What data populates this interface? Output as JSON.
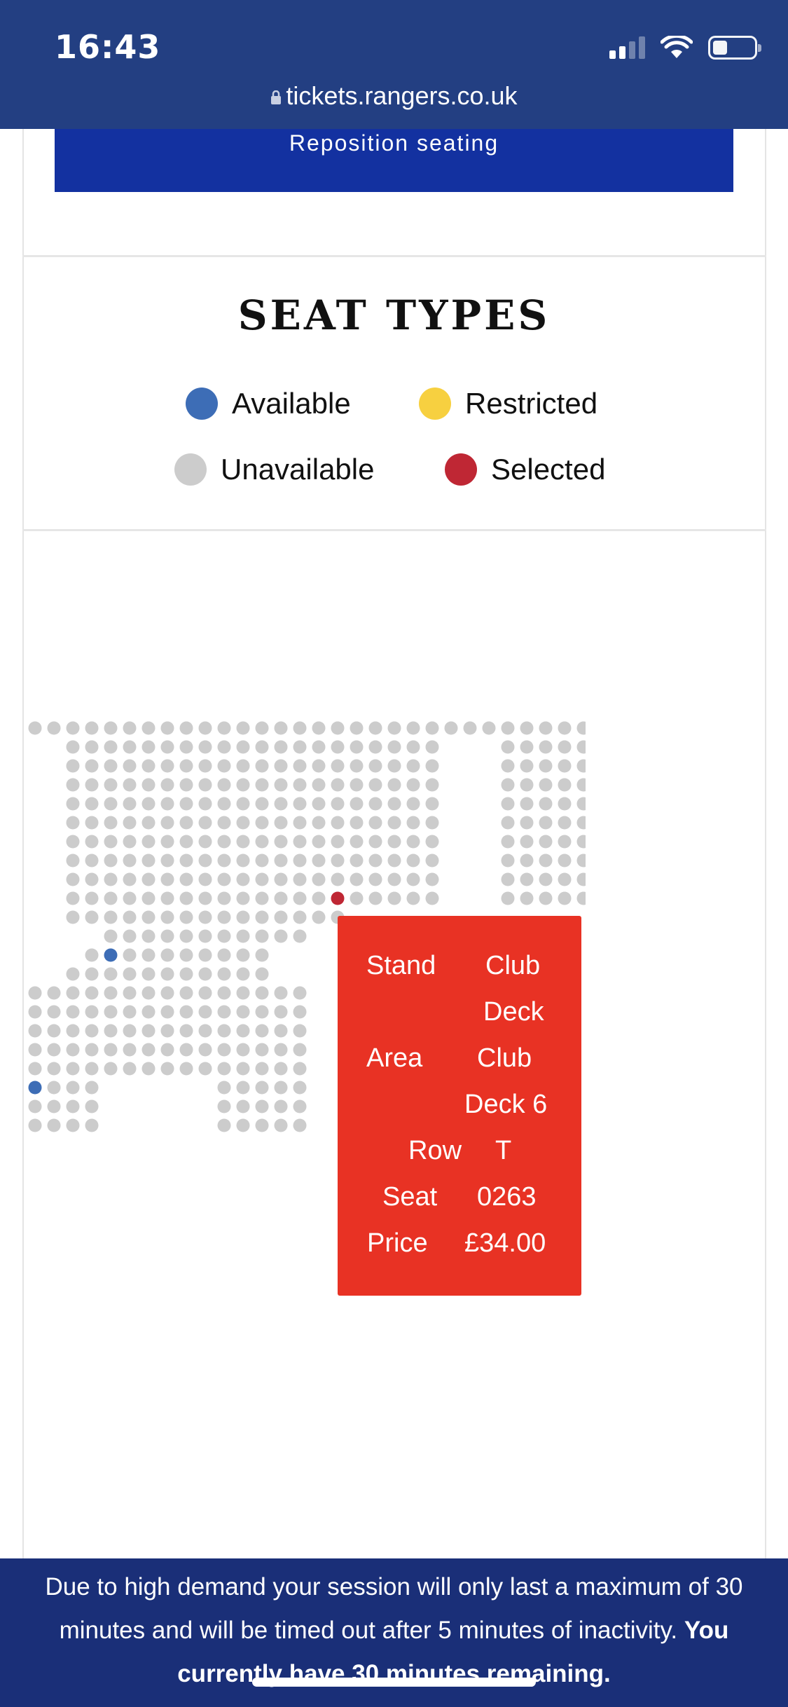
{
  "status_bar": {
    "time": "16:43",
    "url": "tickets.rangers.co.uk",
    "icons": [
      "signal-icon",
      "wifi-icon",
      "battery-icon",
      "lock-icon"
    ]
  },
  "actions": {
    "reposition_label": "Reposition seating"
  },
  "seat_types": {
    "title": "SEAT TYPES",
    "legend": [
      {
        "label": "Available",
        "color": "#3d6db6"
      },
      {
        "label": "Restricted",
        "color": "#f7d040"
      },
      {
        "label": "Unavailable",
        "color": "#cccccc"
      },
      {
        "label": "Selected",
        "color": "#bf2734"
      }
    ]
  },
  "seat_colors": {
    "available": "#3d6db6",
    "unavailable": "#cccccc",
    "selected": "#bf2734"
  },
  "tooltip": {
    "stand_label": "Stand",
    "stand_value_1": "Club",
    "stand_value_2": "Deck",
    "area_label": "Area",
    "area_value_1": "Club",
    "area_value_2": "Deck 6",
    "row_label": "Row",
    "row_value": "T",
    "seat_label": "Seat",
    "seat_value": "0263",
    "price_label": "Price",
    "price_value": "£34.00",
    "background": "#e83224"
  },
  "footer": {
    "message": "Due to high demand your session will only last a maximum of 30 minutes and will be timed out after 5 minutes of inactivity.",
    "remaining": "You currently have 30 minutes remaining."
  }
}
